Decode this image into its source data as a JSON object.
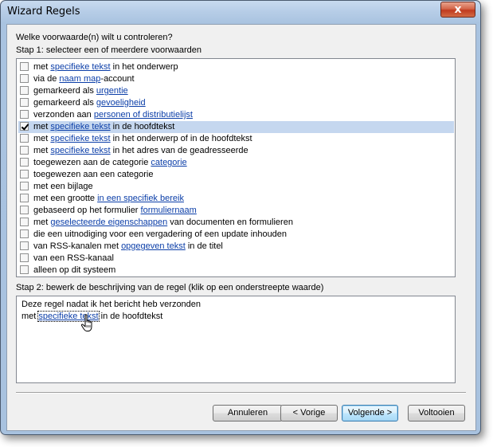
{
  "window": {
    "title": "Wizard Regels",
    "close_glyph": "x"
  },
  "question": "Welke voorwaarde(n) wilt u controleren?",
  "step1_label": "Stap 1: selecteer een of meerdere voorwaarden",
  "conditions": [
    {
      "pre": "met ",
      "link": "specifieke tekst",
      "post": " in het onderwerp",
      "checked": false
    },
    {
      "pre": "via de ",
      "link": "naam map",
      "post": "-account",
      "checked": false
    },
    {
      "pre": "gemarkeerd als ",
      "link": "urgentie",
      "post": "",
      "checked": false
    },
    {
      "pre": "gemarkeerd als ",
      "link": "gevoeligheid",
      "post": "",
      "checked": false
    },
    {
      "pre": "verzonden aan ",
      "link": "personen of distributielijst",
      "post": "",
      "checked": false
    },
    {
      "pre": "met ",
      "link": "specifieke tekst",
      "post": " in de hoofdtekst",
      "checked": true
    },
    {
      "pre": "met ",
      "link": "specifieke tekst",
      "post": " in het onderwerp of in de hoofdtekst",
      "checked": false
    },
    {
      "pre": "met ",
      "link": "specifieke tekst",
      "post": " in het adres van de geadresseerde",
      "checked": false
    },
    {
      "pre": "toegewezen aan de categorie ",
      "link": "categorie",
      "post": "",
      "checked": false
    },
    {
      "pre": "toegewezen aan een categorie",
      "link": "",
      "post": "",
      "checked": false
    },
    {
      "pre": "met een bijlage",
      "link": "",
      "post": "",
      "checked": false
    },
    {
      "pre": "met een grootte ",
      "link": "in een specifiek bereik",
      "post": "",
      "checked": false
    },
    {
      "pre": "gebaseerd op het formulier ",
      "link": "formuliernaam",
      "post": "",
      "checked": false
    },
    {
      "pre": "met ",
      "link": "geselecteerde eigenschappen",
      "post": " van documenten en formulieren",
      "checked": false
    },
    {
      "pre": "die een uitnodiging voor een vergadering of een update inhouden",
      "link": "",
      "post": "",
      "checked": false
    },
    {
      "pre": "van RSS-kanalen met ",
      "link": "opgegeven tekst",
      "post": " in de titel",
      "checked": false
    },
    {
      "pre": "van een RSS-kanaal",
      "link": "",
      "post": "",
      "checked": false
    },
    {
      "pre": "alleen op dit systeem",
      "link": "",
      "post": "",
      "checked": false
    }
  ],
  "step2_label": "Stap 2: bewerk de beschrijving van de regel (klik op een onderstreepte waarde)",
  "description": {
    "line1": "Deze regel nadat ik het bericht heb verzonden",
    "line2_pre": "met ",
    "line2_link": "specifieke tekst",
    "line2_post": " in de hoofdtekst"
  },
  "buttons": {
    "cancel": "Annuleren",
    "back": "< Vorige",
    "next": "Volgende >",
    "finish": "Voltooien"
  },
  "icons": {
    "cursor": "hand-pointer-icon",
    "check": "checkmark-icon"
  }
}
